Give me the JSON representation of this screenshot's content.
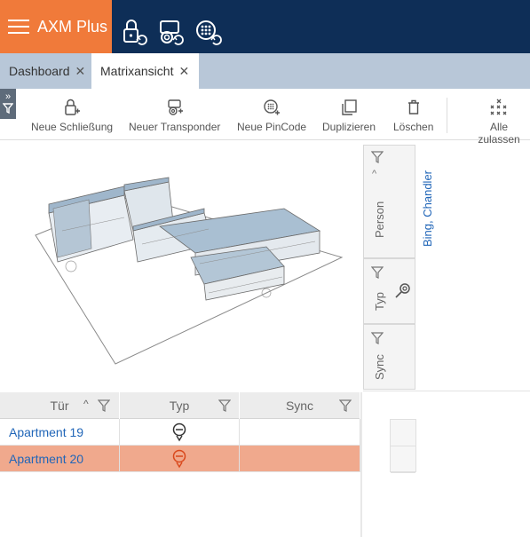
{
  "app": {
    "title": "AXM Plus"
  },
  "header_icons": [
    "lock-sync-icon",
    "transponder-sync-icon",
    "pincode-sync-icon"
  ],
  "tabs": [
    {
      "label": "Dashboard",
      "close": "✕"
    },
    {
      "label": "Matrixansicht",
      "close": "✕"
    }
  ],
  "toolbar": {
    "neue_schliessung": "Neue Schließung",
    "neuer_transponder": "Neuer Transponder",
    "neue_pincode": "Neue PinCode",
    "duplizieren": "Duplizieren",
    "loeschen": "Löschen",
    "alle_zulassen": "Alle zulassen"
  },
  "columns_right": {
    "person": "Person",
    "typ": "Typ",
    "sync": "Sync",
    "person_name": "Bing, Chandler"
  },
  "grid": {
    "headers": {
      "tuer": "Tür",
      "typ": "Typ",
      "sync": "Sync"
    },
    "rows": [
      {
        "tuer": "Apartment 19"
      },
      {
        "tuer": "Apartment 20"
      }
    ]
  },
  "colors": {
    "header": "#0e2e57",
    "brand": "#f07a3a",
    "tab_bar": "#b8c7d8",
    "selected_row": "#f0a98d",
    "link": "#2166b8"
  }
}
